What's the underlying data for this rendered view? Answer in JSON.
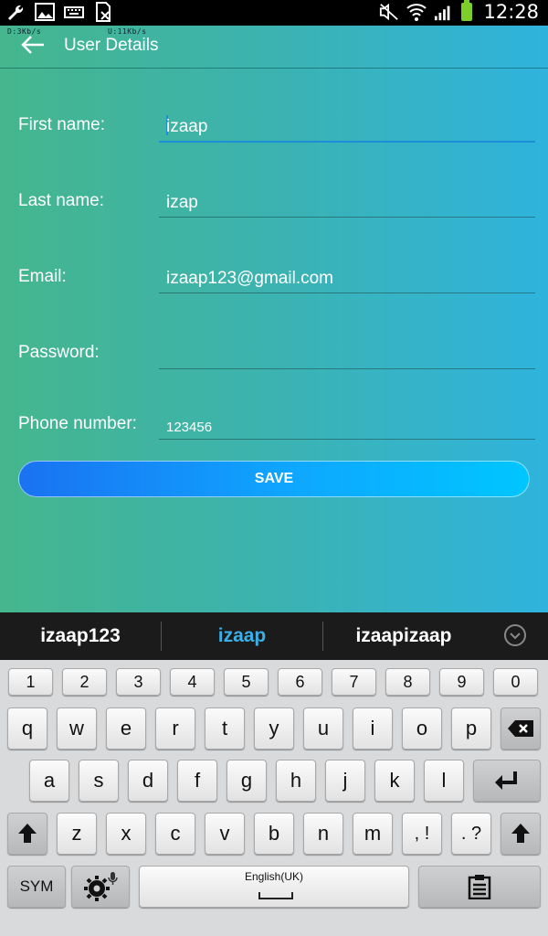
{
  "status_bar": {
    "time": "12:28",
    "download_speed": "D:3Kb/s",
    "upload_speed": "U:11Kb/s",
    "icons": [
      "wrench-icon",
      "image-icon",
      "keyboard-icon",
      "sim-icon",
      "mute-icon",
      "wifi-icon",
      "signal-icon",
      "battery-icon"
    ],
    "battery_color": "#7ccf2a"
  },
  "app_bar": {
    "title": "User Details"
  },
  "form": {
    "first_name": {
      "label": "First name:",
      "value": "izaap"
    },
    "last_name": {
      "label": "Last name:",
      "value": "izap"
    },
    "email": {
      "label": "Email:",
      "value": "izaap123@gmail.com"
    },
    "password": {
      "label": "Password:",
      "value": ""
    },
    "phone": {
      "label": "Phone number:",
      "value": "123456"
    },
    "save_label": "SAVE"
  },
  "suggestions": {
    "items": [
      "izaap123",
      "izaap",
      "izaapizaap"
    ],
    "active_color": "#3ab0e6"
  },
  "keyboard": {
    "numbers": [
      "1",
      "2",
      "3",
      "4",
      "5",
      "6",
      "7",
      "8",
      "9",
      "0"
    ],
    "row1": [
      "q",
      "w",
      "e",
      "r",
      "t",
      "y",
      "u",
      "i",
      "o",
      "p"
    ],
    "row2": [
      "a",
      "s",
      "d",
      "f",
      "g",
      "h",
      "j",
      "k",
      "l"
    ],
    "row3": [
      "z",
      "x",
      "c",
      "v",
      "b",
      "n",
      "m"
    ],
    "comma_key": ", !",
    "period_key": ". ?",
    "sym_label": "SYM",
    "space_label": "English(UK)"
  }
}
